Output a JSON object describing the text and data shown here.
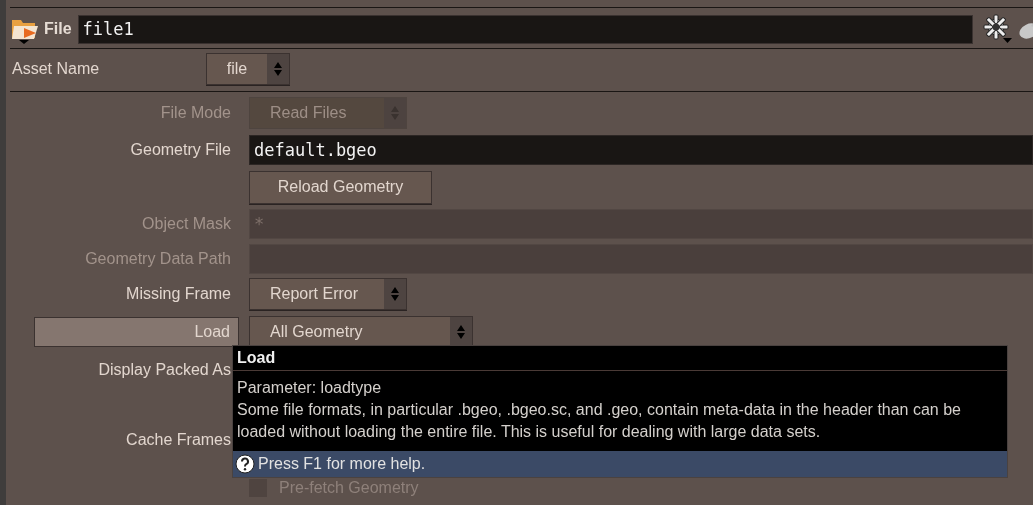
{
  "header": {
    "type_label": "File",
    "node_name": "file1"
  },
  "asset_name": {
    "label": "Asset Name",
    "value": "file"
  },
  "parameters": [
    {
      "kind": "menu",
      "label": "File Mode",
      "value": "Read Files",
      "disabled": true,
      "selected": false
    },
    {
      "kind": "text",
      "label": "Geometry File",
      "value": "default.bgeo",
      "disabled": false,
      "selected": false
    },
    {
      "kind": "button",
      "label": "Reload Geometry"
    },
    {
      "kind": "text",
      "label": "Object Mask",
      "value": "*",
      "disabled": true,
      "selected": false
    },
    {
      "kind": "text",
      "label": "Geometry Data Path",
      "disabled": true,
      "selected": false
    },
    {
      "kind": "menu",
      "label": "Missing Frame",
      "value": "Report Error",
      "disabled": false,
      "selected": false
    },
    {
      "kind": "menu",
      "label": "Load",
      "value": "All Geometry",
      "disabled": false,
      "selected": true
    },
    {
      "kind": "label",
      "label": "Display Packed As"
    },
    {
      "kind": "label",
      "label": "Cache Frames"
    },
    {
      "kind": "checkbox",
      "label": "Pre-fetch Geometry",
      "checked": false,
      "disabled": true
    }
  ],
  "tooltip": {
    "title": "Load",
    "lines": [
      "Parameter: loadtype",
      "Some file formats, in particular .bgeo, .bgeo.sc, and .geo, contain meta-data in the header than can be",
      "loaded without loading the entire file. This is useful for dealing with large data sets."
    ],
    "footer": "Press F1 for more help."
  }
}
